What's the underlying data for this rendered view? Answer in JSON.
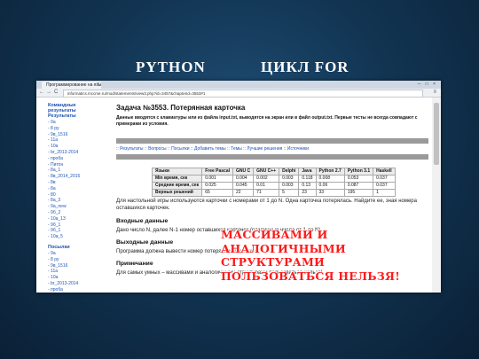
{
  "slide": {
    "title_left": "PYTHON",
    "title_right": "ЦИКЛ FOR"
  },
  "browser": {
    "tab_title": "Программирование на язы",
    "tab_close": "×",
    "window_controls": "─ □ ×",
    "nav": {
      "back": "←",
      "forward": "→",
      "reload": "C"
    },
    "url": "informatics.mccme.ru/mod/statements/view3.php?id=3457&chapterid=3553#1",
    "menu": "≡"
  },
  "sidebar": {
    "top_link": "Командные результаты",
    "results_heading": "Результаты",
    "results_items": [
      "- 9a",
      "- 8 py",
      "- 9в_1516",
      "- 11a",
      "- 10a",
      "- br_2013-2014",
      "- проба",
      "- Питон",
      "- 8a_1",
      "- 8в_2014_2015",
      "- 8в",
      "- 8a",
      "- 80",
      "- 8a_3",
      "- 9a_new",
      "- 9б_2",
      "- 10a_13",
      "- 9б_1",
      "- 9б_1",
      "- 10a_5"
    ],
    "posts_heading": "Посылки",
    "posts_items": [
      "- 9a",
      "- 8 py",
      "- 9в_1516",
      "- 11a",
      "- 10a",
      "- br_2013-2014",
      "- проба"
    ]
  },
  "task": {
    "title": "Задача №3553. Потерянная карточка",
    "desc_bold": "Данные вводятся с клавиатуры или из файла input.txt, выводятся на экран или в файл output.txt. Первые тесты не всегда совпадают с примерами из условия.",
    "nav_links": [
      ":: Результаты",
      ":: Вопросы",
      ":: Посылки",
      ":: Добавить темы",
      ":: Темы",
      ":: Лучшие решения",
      ":: Источники"
    ],
    "stats": {
      "headers": [
        "Языки",
        "Free Pascal",
        "GNU C",
        "GNU C++",
        "Delphi",
        "Java",
        "Python 2.7",
        "Python 3.1",
        "Haskell"
      ],
      "rows": [
        [
          "Min время, сек",
          "0.001",
          "0.004",
          "0.002",
          "0.003",
          "0.118",
          "0.008",
          "0.053",
          "0.037"
        ],
        [
          "Средние время, сек",
          "0.025",
          "0.045",
          "0.01",
          "0.003",
          "0.13",
          "0.06",
          "0.087",
          "0.037"
        ],
        [
          "Верных решений",
          "65",
          "22",
          "71",
          "5",
          "23",
          "33",
          "195",
          "1"
        ]
      ]
    },
    "statement": "Для настольной игры используются карточки с номерами от 1 до N. Одна карточка потерялась. Найдите ее, зная номера оставшихся карточек.",
    "input_heading": "Входные данные",
    "input_text": "Дано число N, далее N-1 номер оставшихся карточек (различные числа от 1 до N).",
    "output_heading": "Выходные данные",
    "output_text": "Программа должна вывести номер потерянной карточки.",
    "note_heading": "Примечание",
    "note_text": "Для самых умных – массивами и аналогичными структурами пользоваться нельзя!"
  },
  "overlay": {
    "lines": [
      "МАССИВАМИ И",
      "АНАЛОГИЧНЫМИ",
      "СТРУКТУРАМИ",
      "ПОЛЬЗОВАТЬСЯ НЕЛЬЗЯ!"
    ],
    "color": "#ff1a1a"
  }
}
